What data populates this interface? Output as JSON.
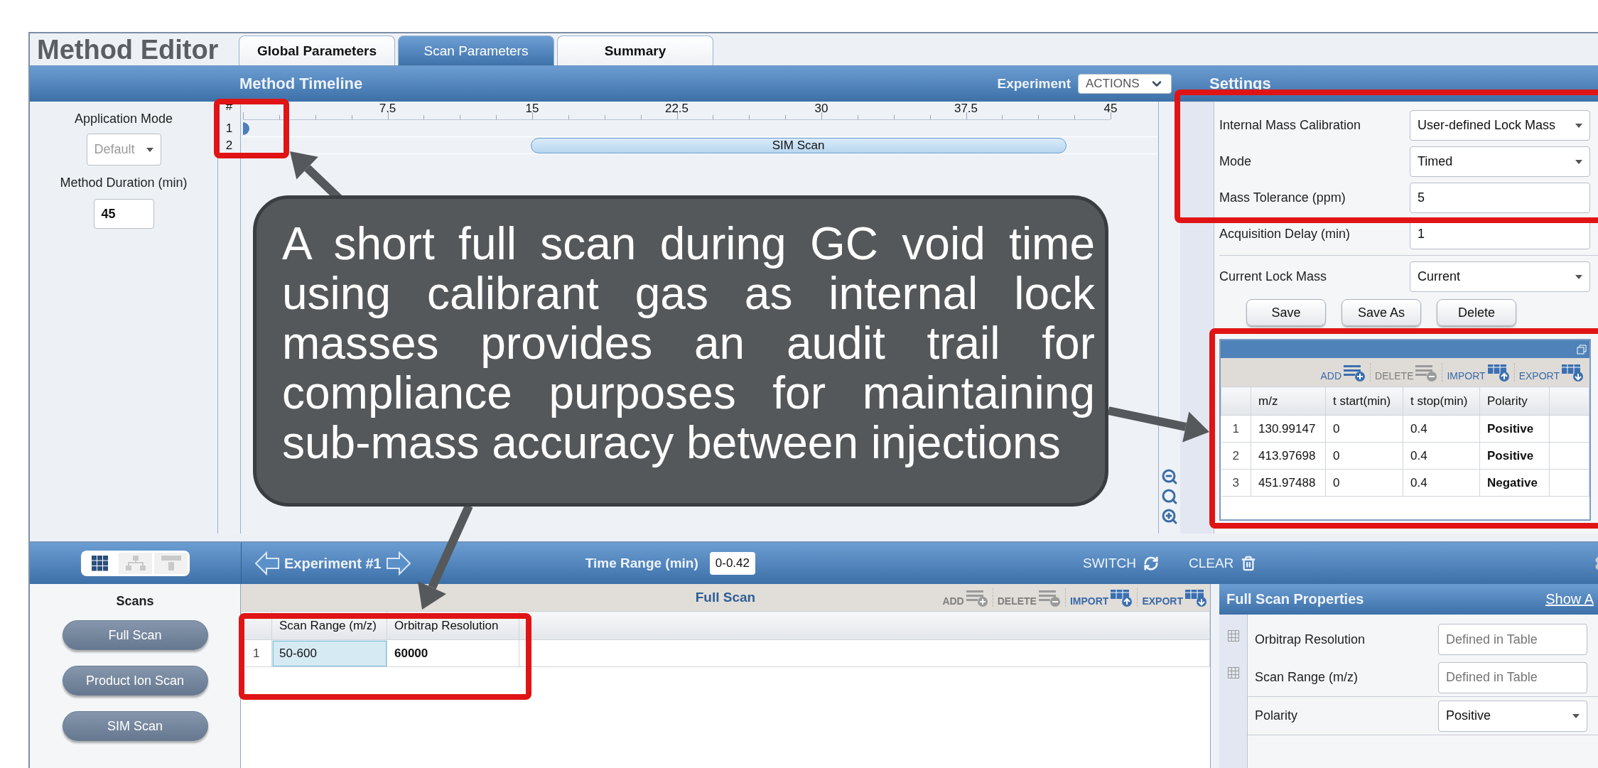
{
  "title": "Method Editor",
  "tabs": [
    {
      "label": "Global Parameters",
      "selected": false
    },
    {
      "label": "Scan Parameters",
      "selected": true
    },
    {
      "label": "Summary",
      "selected": false
    }
  ],
  "method": {
    "application_mode_label": "Application Mode",
    "application_mode": "Default",
    "application_mode_disabled": true,
    "duration_label": "Method Duration (min)",
    "duration": "45"
  },
  "timeline": {
    "title": "Method Timeline",
    "experiment_label": "Experiment",
    "actions": "ACTIONS",
    "hash": "#",
    "ticks": [
      "7.5",
      "15",
      "22.5",
      "30",
      "37.5",
      "45"
    ],
    "rows": [
      {
        "number": "1",
        "kind": "marker"
      },
      {
        "number": "2",
        "kind": "bar",
        "label": "SIM Scan"
      }
    ]
  },
  "settings": {
    "title": "Settings",
    "fields": [
      {
        "label": "Internal Mass Calibration",
        "value": "User-defined Lock Mass",
        "kind": "dropdown"
      },
      {
        "label": "Mode",
        "value": "Timed",
        "kind": "dropdown"
      },
      {
        "label": "Mass Tolerance (ppm)",
        "value": "5",
        "kind": "input"
      },
      {
        "label": "Acquisition Delay (min)",
        "value": "1",
        "kind": "input"
      }
    ],
    "lock_mass": {
      "label": "Current Lock Mass",
      "value": "Current"
    },
    "buttons": [
      "Save",
      "Save As",
      "Delete"
    ],
    "lock_table": {
      "toolbar": [
        {
          "label": "ADD",
          "kind": "add",
          "disabled": false
        },
        {
          "label": "DELETE",
          "kind": "delete",
          "disabled": true
        },
        {
          "label": "IMPORT",
          "kind": "import",
          "disabled": false
        },
        {
          "label": "EXPORT",
          "kind": "export",
          "disabled": false
        }
      ],
      "columns": [
        "",
        "m/z",
        "t start(min)",
        "t stop(min)",
        "Polarity"
      ],
      "rows": [
        [
          "1",
          "130.99147",
          "0",
          "0.4",
          "Positive"
        ],
        [
          "2",
          "413.97698",
          "0",
          "0.4",
          "Positive"
        ],
        [
          "3",
          "451.97488",
          "0",
          "0.4",
          "Negative"
        ]
      ]
    }
  },
  "experiment_bar": {
    "view_modes": [
      {
        "kind": "grid",
        "selected": true
      },
      {
        "kind": "tree",
        "selected": false
      },
      {
        "kind": "columns",
        "selected": false
      }
    ],
    "experiment": "Experiment #1",
    "time_range_label": "Time Range (min)",
    "time_range": "0-0.42",
    "switch": "SWITCH",
    "clear": "CLEAR"
  },
  "scans": {
    "title": "Scans",
    "items": [
      "Full Scan",
      "Product Ion Scan",
      "SIM Scan"
    ]
  },
  "scan_table": {
    "title": "Full Scan",
    "toolbar": [
      {
        "label": "ADD",
        "kind": "add",
        "disabled": true
      },
      {
        "label": "DELETE",
        "kind": "delete",
        "disabled": true
      },
      {
        "label": "IMPORT",
        "kind": "import",
        "disabled": false
      },
      {
        "label": "EXPORT",
        "kind": "export",
        "disabled": false
      }
    ],
    "columns": [
      "Scan Range (m/z)",
      "Orbitrap Resolution"
    ],
    "rows": [
      {
        "number": "1",
        "cells": [
          {
            "value": "50-600",
            "selected": true
          },
          {
            "value": "60000",
            "selected": false
          }
        ]
      }
    ]
  },
  "properties": {
    "title": "Full Scan Properties",
    "show_all": "Show A",
    "fields": [
      {
        "label": "Orbitrap Resolution",
        "placeholder": "Defined in Table",
        "kind": "table_input"
      },
      {
        "label": "Scan Range (m/z)",
        "placeholder": "Defined in Table",
        "kind": "table_input"
      },
      {
        "label": "Polarity",
        "value": "Positive",
        "kind": "dropdown"
      }
    ]
  },
  "callout": {
    "text": "A short full scan during GC void time using calibrant gas as internal lock masses provides an audit trail for compliance purposes for maintaining sub-mass accuracy between injections"
  }
}
